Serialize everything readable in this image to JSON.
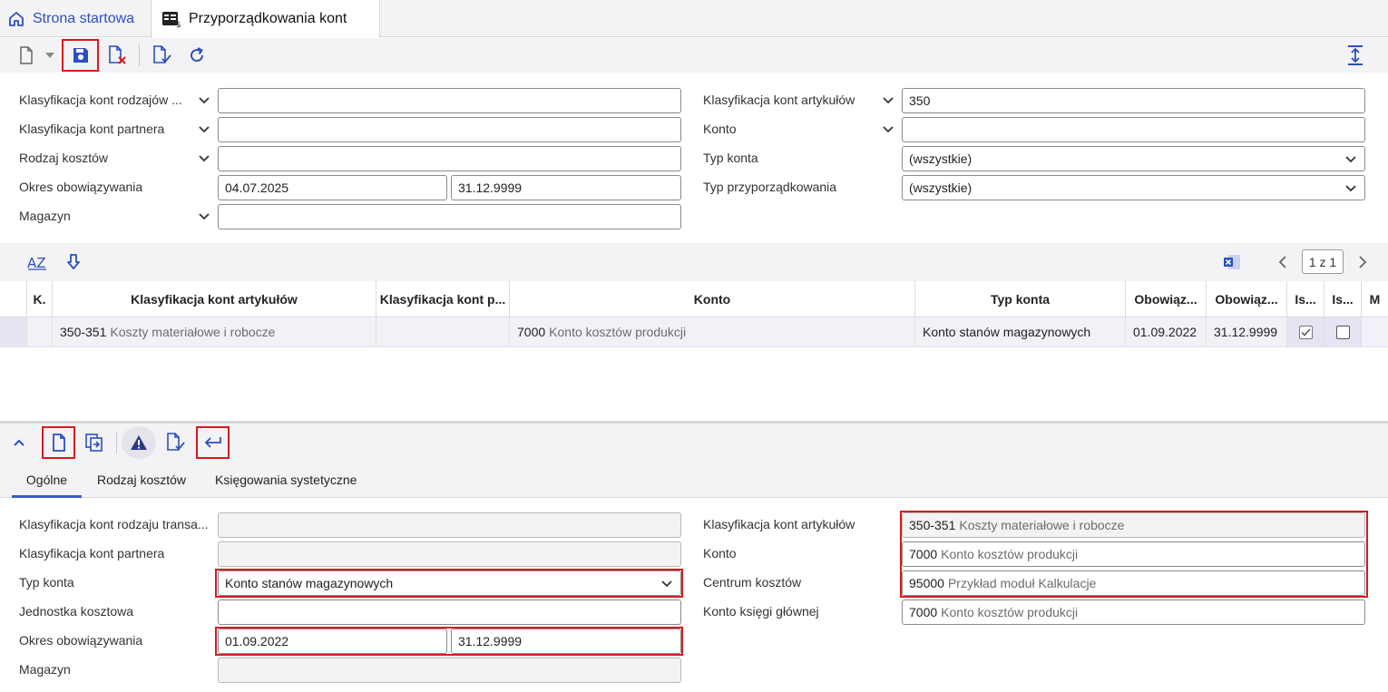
{
  "tabs": {
    "home": "Strona startowa",
    "active": "Przyporządkowania kont"
  },
  "filter": {
    "left_labels": [
      "Klasyfikacja kont rodzajów ...",
      "Klasyfikacja kont partnera",
      "Rodzaj kosztów",
      "Okres obowiązywania",
      "Magazyn"
    ],
    "right_labels": [
      "Klasyfikacja kont artykułów",
      "Konto",
      "Typ konta",
      "Typ przyporządkowania"
    ],
    "values": {
      "transaction_class": "",
      "partner_class": "",
      "cost_type": "",
      "valid_from": "04.07.2025",
      "valid_to": "31.12.9999",
      "warehouse": "",
      "article_class": "350",
      "account": "",
      "account_type": "(wszystkie)",
      "assignment_type": "(wszystkie)"
    }
  },
  "grid": {
    "pagination": "1 z 1",
    "headers": [
      "K.",
      "Klasyfikacja kont artykułów",
      "Klasyfikacja kont p...",
      "Konto",
      "Typ konta",
      "Obowiąz...",
      "Obowiąz...",
      "Is...",
      "Is...",
      "M"
    ],
    "row": {
      "article_code": "350-351",
      "article_desc": "Koszty materiałowe i robocze",
      "partner": "",
      "account_code": "7000",
      "account_desc": "Konto kosztów produkcji",
      "account_type": "Konto stanów magazynowych",
      "valid_from": "01.09.2022",
      "valid_to": "31.12.9999",
      "is1_checked": true,
      "is2_checked": false
    }
  },
  "detail": {
    "tabs": [
      "Ogólne",
      "Rodzaj kosztów",
      "Księgowania systetyczne"
    ],
    "left_labels": [
      "Klasyfikacja kont rodzaju transa...",
      "Klasyfikacja kont partnera",
      "Typ konta",
      "Jednostka kosztowa",
      "Okres obowiązywania",
      "Magazyn"
    ],
    "right_labels": [
      "Klasyfikacja kont artykułów",
      "Konto",
      "Centrum kosztów",
      "Konto księgi głównej"
    ],
    "values": {
      "transaction_class": "",
      "partner_class": "",
      "account_type": "Konto stanów magazynowych",
      "cost_unit": "",
      "valid_from": "01.09.2022",
      "valid_to": "31.12.9999",
      "warehouse": "",
      "article_code": "350-351",
      "article_desc": "Koszty materiałowe i robocze",
      "account_code": "7000",
      "account_desc": "Konto kosztów produkcji",
      "cost_center_code": "95000",
      "cost_center_desc": "Przykład moduł Kalkulacje",
      "gl_code": "7000",
      "gl_desc": "Konto kosztów produkcji"
    }
  },
  "colors": {
    "accent": "#2b4fbf",
    "highlight": "#d9191e"
  }
}
